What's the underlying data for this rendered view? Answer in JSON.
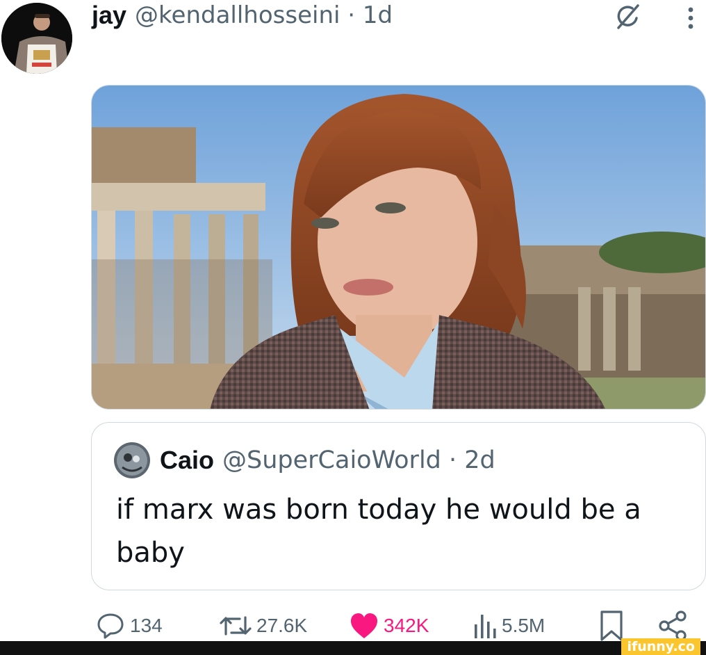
{
  "post": {
    "author_name": "jay",
    "author_meta": "@kendallhosseini · 1d",
    "avatar_label": "jay avatar"
  },
  "quote": {
    "author_name": "Caio",
    "author_meta": "@SuperCaioWorld · 2d",
    "text": "if marx was born today he would be a baby"
  },
  "actions": {
    "replies": "134",
    "reposts": "27.6K",
    "likes": "342K",
    "views": "5.5M"
  },
  "icons": {
    "grok": "grok-icon",
    "more": "more-vertical-icon",
    "reply": "reply-icon",
    "repost": "repost-icon",
    "like": "heart-icon",
    "views": "views-chart-icon",
    "bookmark": "bookmark-icon",
    "share": "share-icon"
  },
  "colors": {
    "like_accent": "#f91880",
    "muted_text": "#536471",
    "watermark_bg": "#fbc52e"
  },
  "watermark": "ifunny.co"
}
